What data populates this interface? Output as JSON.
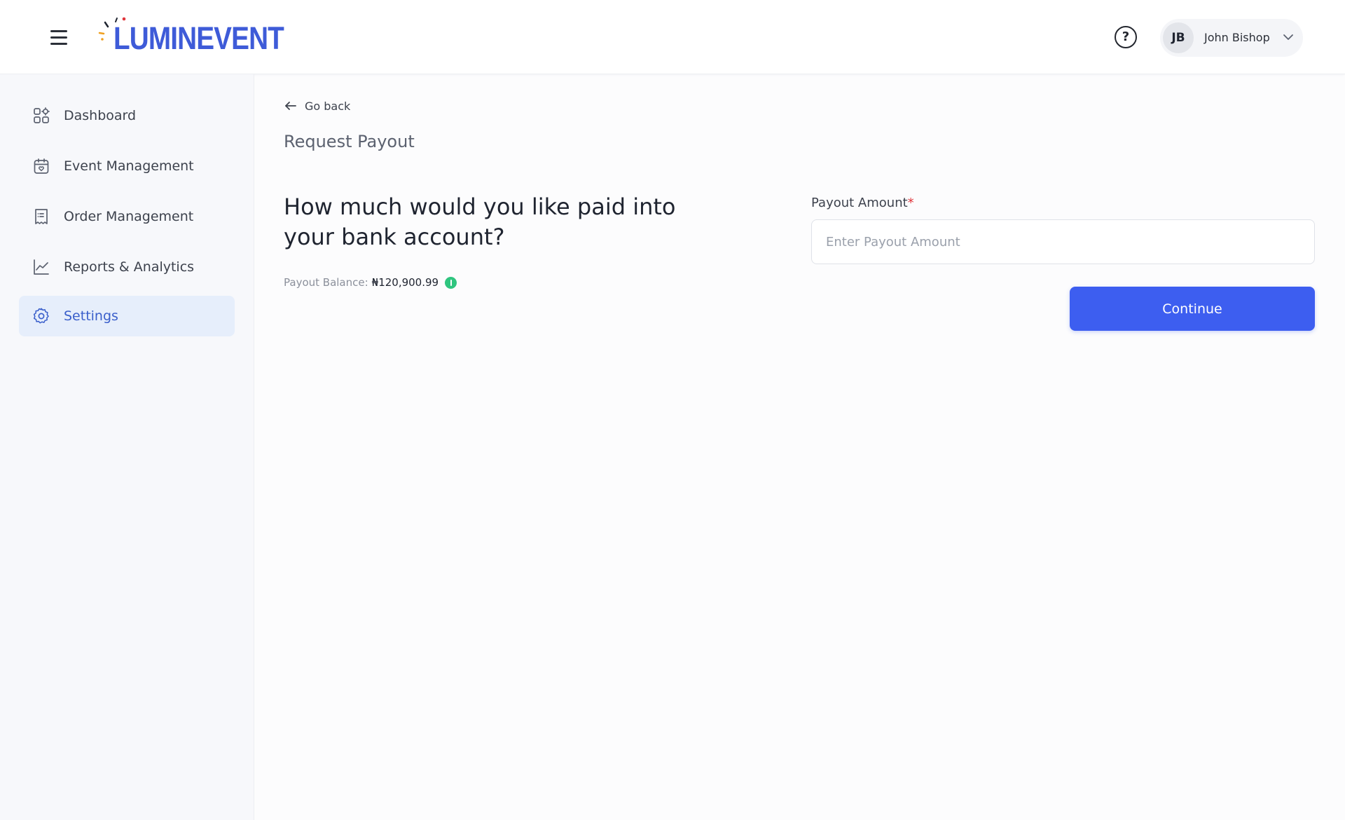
{
  "brand": {
    "name": "LUMINEVENT",
    "color": "#3e5bd8"
  },
  "header": {
    "menu_icon": "hamburger-menu-icon",
    "help_icon": "help-circle-icon",
    "help_glyph": "?",
    "user": {
      "initials": "JB",
      "name": "John Bishop",
      "chevron_icon": "chevron-down-icon"
    }
  },
  "sidebar": {
    "items": [
      {
        "label": "Dashboard",
        "icon": "dashboard-grid-icon",
        "active": false
      },
      {
        "label": "Event Management",
        "icon": "calendar-icon",
        "active": false
      },
      {
        "label": "Order Management",
        "icon": "receipt-icon",
        "active": false
      },
      {
        "label": "Reports & Analytics",
        "icon": "line-chart-icon",
        "active": false
      },
      {
        "label": "Settings",
        "icon": "gear-icon",
        "active": true
      }
    ]
  },
  "main": {
    "back_label": "Go back",
    "page_title": "Request Payout",
    "question": "How much would you like paid into your bank account?",
    "balance": {
      "label": "Payout Balance:",
      "value": "₦120,900.99",
      "info_color": "#2fc57f"
    },
    "form": {
      "amount_label": "Payout Amount",
      "required_marker": "*",
      "amount_value": "",
      "amount_placeholder": "Enter Payout Amount",
      "continue_label": "Continue",
      "accent": "#3d5ef0"
    }
  }
}
